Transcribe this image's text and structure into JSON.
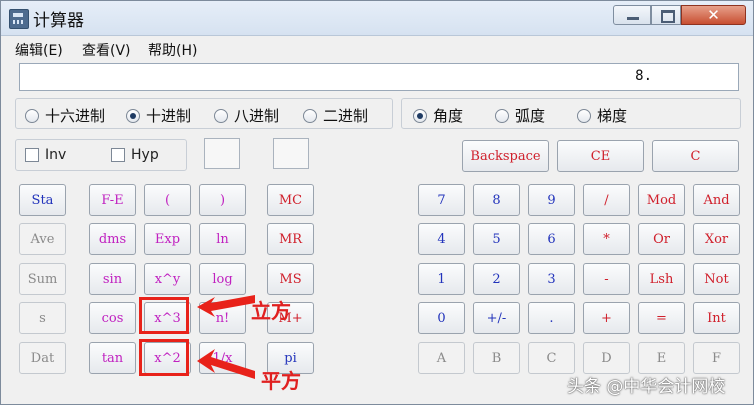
{
  "window": {
    "title": "计算器"
  },
  "menu": [
    "编辑(E)",
    "查看(V)",
    "帮助(H)"
  ],
  "display": {
    "value": "8."
  },
  "base_options": [
    {
      "label": "十六进制",
      "selected": false
    },
    {
      "label": "十进制",
      "selected": true
    },
    {
      "label": "八进制",
      "selected": false
    },
    {
      "label": "二进制",
      "selected": false
    }
  ],
  "angle_options": [
    {
      "label": "角度",
      "selected": true
    },
    {
      "label": "弧度",
      "selected": false
    },
    {
      "label": "梯度",
      "selected": false
    }
  ],
  "checks": {
    "inv": "Inv",
    "hyp": "Hyp"
  },
  "top_buttons": {
    "backspace": "Backspace",
    "ce": "CE",
    "c": "C"
  },
  "stat_col": [
    "Sta",
    "Ave",
    "Sum",
    "s",
    "Dat"
  ],
  "sci_rows": [
    [
      "F-E",
      "(",
      ")"
    ],
    [
      "dms",
      "Exp",
      "ln"
    ],
    [
      "sin",
      "x^y",
      "log"
    ],
    [
      "cos",
      "x^3",
      "n!"
    ],
    [
      "tan",
      "x^2",
      "1/x"
    ]
  ],
  "mem_col": [
    "MC",
    "MR",
    "MS",
    "M+",
    "pi"
  ],
  "num_rows": [
    [
      "7",
      "8",
      "9",
      "/",
      "Mod",
      "And"
    ],
    [
      "4",
      "5",
      "6",
      "*",
      "Or",
      "Xor"
    ],
    [
      "1",
      "2",
      "3",
      "-",
      "Lsh",
      "Not"
    ],
    [
      "0",
      "+/-",
      ".",
      "+",
      "=",
      "Int"
    ],
    [
      "A",
      "B",
      "C",
      "D",
      "E",
      "F"
    ]
  ],
  "annotations": {
    "cube": "立方",
    "square": "平方"
  },
  "watermark": "头条 @中华会计网校",
  "colors": {
    "accent_red": "#e8221a"
  }
}
